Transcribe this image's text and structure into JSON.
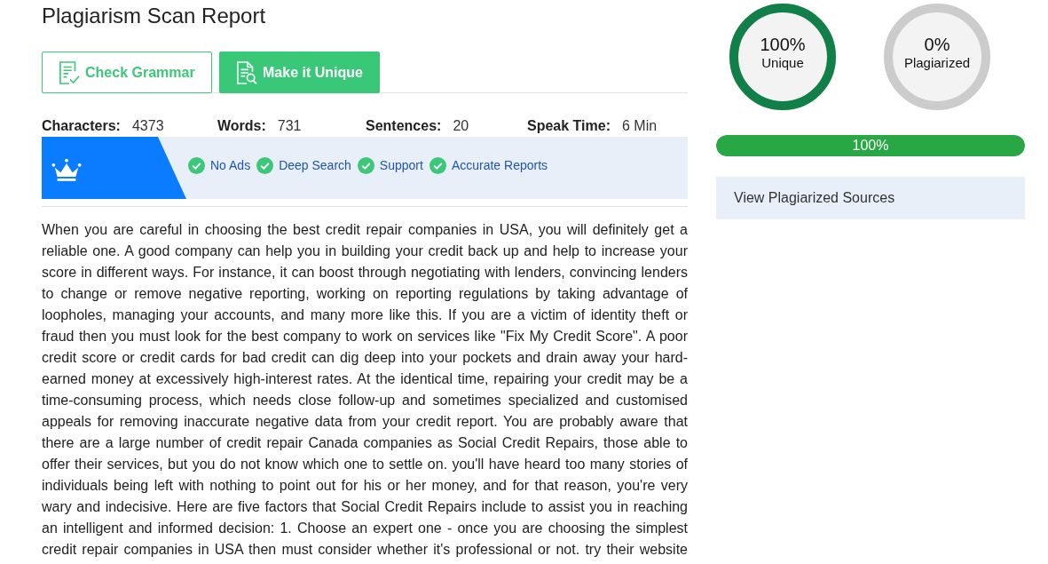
{
  "title": "Plagiarism Scan Report",
  "actions": [
    {
      "kind": "outline",
      "label": "Check Grammar"
    },
    {
      "kind": "filled",
      "label": "Make it Unique"
    }
  ],
  "stats": [
    {
      "label": "Characters:",
      "value": "4373"
    },
    {
      "label": "Words:",
      "value": "731"
    },
    {
      "label": "Sentences:",
      "value": "20"
    },
    {
      "label": "Speak Time:",
      "value": "6 Min"
    }
  ],
  "premium_banner": {
    "features": [
      "No Ads",
      "Deep Search",
      "Support",
      "Accurate Reports"
    ]
  },
  "report_text": "When you are careful in choosing the best credit repair companies in USA, you will definitely get a reliable one. A good company can help you in building your credit back up and help to increase your score in different ways. For instance, it can boost through negotiating with lenders, convincing lenders to change or remove negative reporting, working on reporting regulations by taking advantage of loopholes, managing your accounts, and many more like this. If you are a victim of identity theft or fraud then you must look for the best company to work on services like \"Fix My Credit Score\". A poor credit score or credit cards for bad credit can dig deep into your pockets and drain away your hard-earned money at excessively high-interest rates. At the identical time, repairing your credit may be a time-consuming process, which needs close follow-up and sometimes specialized and customised appeals for removing inaccurate negative data from your credit report. You are probably aware that there are a large number of credit repair Canada companies as Social Credit Repairs, those able to offer their services, but you do not know which one to settle on. you'll have heard too many stories of individuals being left with nothing to point out for his or her money, and for that reason, you're very wary and indecisive. Here are five factors that Social Credit Repairs include to assist you in reaching an intelligent and informed decision: 1. Choose an expert one - once you are choosing the simplest credit repair companies in USA then must consider whether it's professional or not. try their website",
  "results": [
    {
      "value": "100%",
      "label": "Unique",
      "level": 1
    },
    {
      "value": "0%",
      "label": "Plagiarized",
      "level": 0
    }
  ],
  "progress": {
    "level": 1,
    "reading": "100%"
  },
  "sources_button": {
    "label": "View Plagiarized Sources"
  }
}
